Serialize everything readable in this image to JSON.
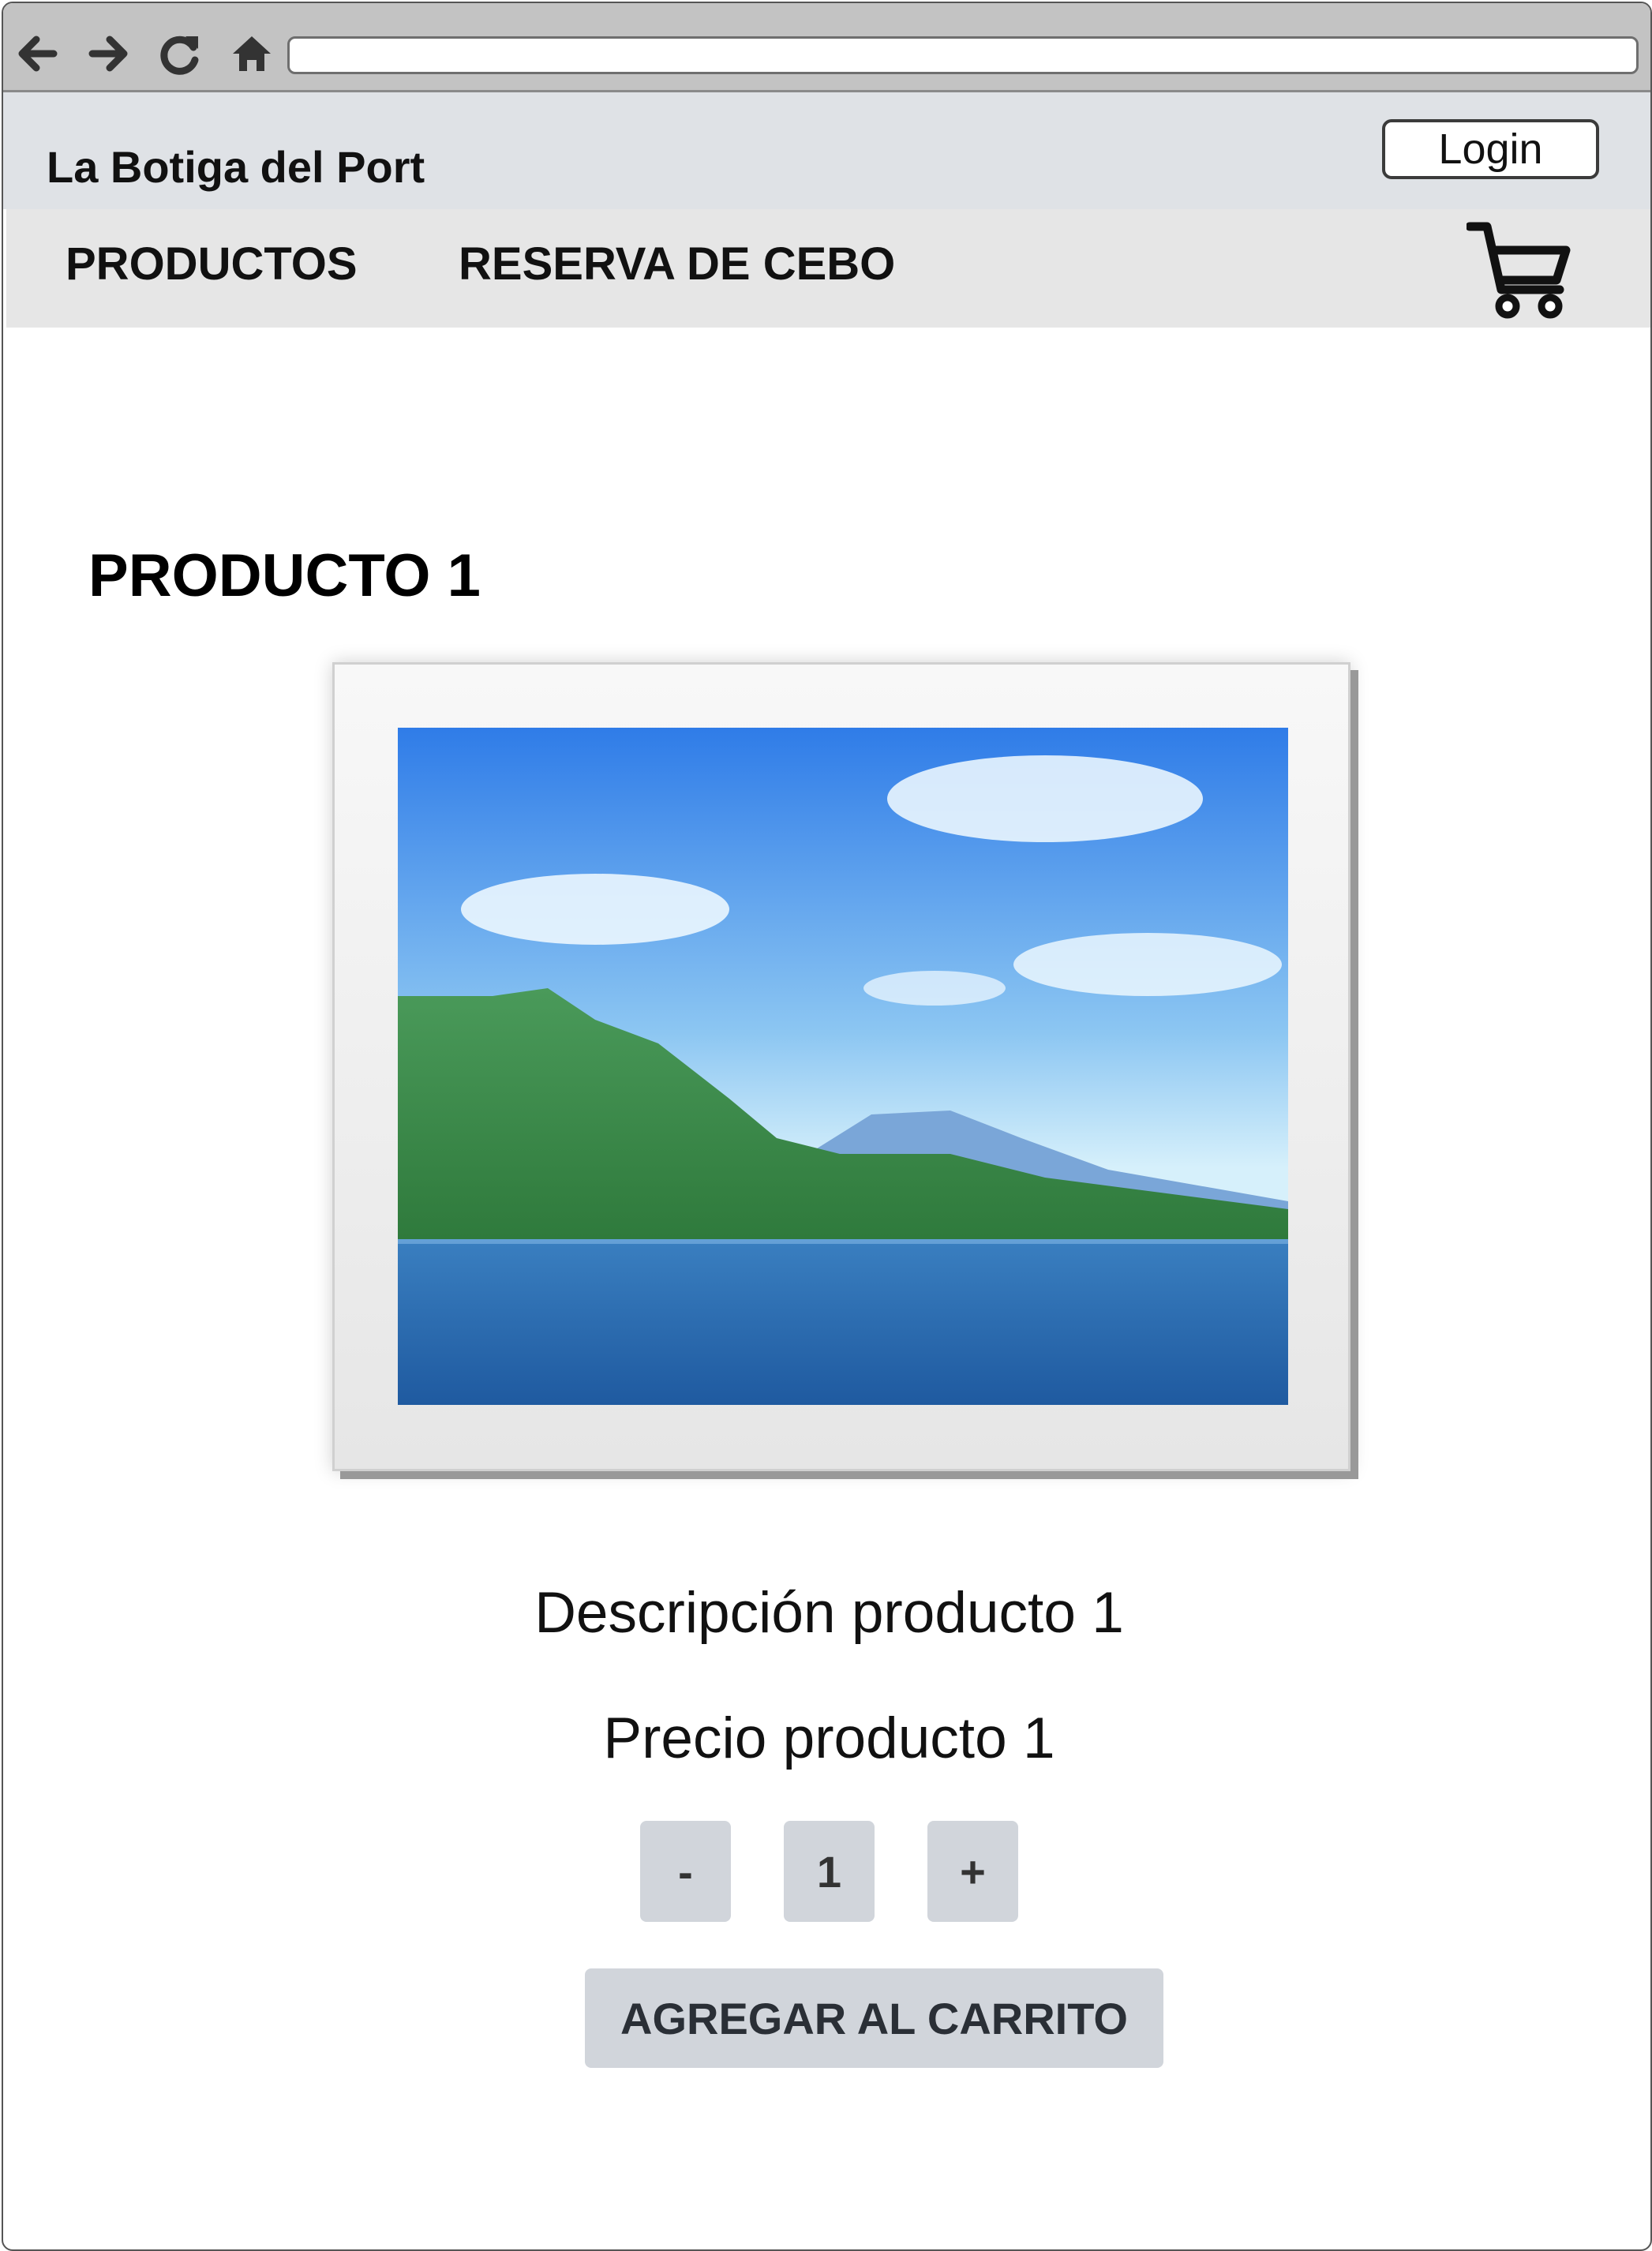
{
  "browser": {
    "icons": [
      "back-arrow-icon",
      "forward-arrow-icon",
      "reload-icon",
      "home-icon"
    ],
    "url": ""
  },
  "header": {
    "brand": "La Botiga del Port",
    "login_label": "Login"
  },
  "nav": {
    "items": [
      {
        "label": "PRODUCTOS"
      },
      {
        "label": "RESERVA DE CEBO"
      }
    ],
    "cart_icon": "cart-icon"
  },
  "product": {
    "title": "PRODUCTO 1",
    "image_icon": "landscape-image-placeholder",
    "description": "Descripción producto 1",
    "price": "Precio producto 1",
    "quantity": {
      "decrement_label": "-",
      "value": "1",
      "increment_label": "+"
    },
    "add_to_cart_label": "AGREGAR AL CARRITO"
  }
}
